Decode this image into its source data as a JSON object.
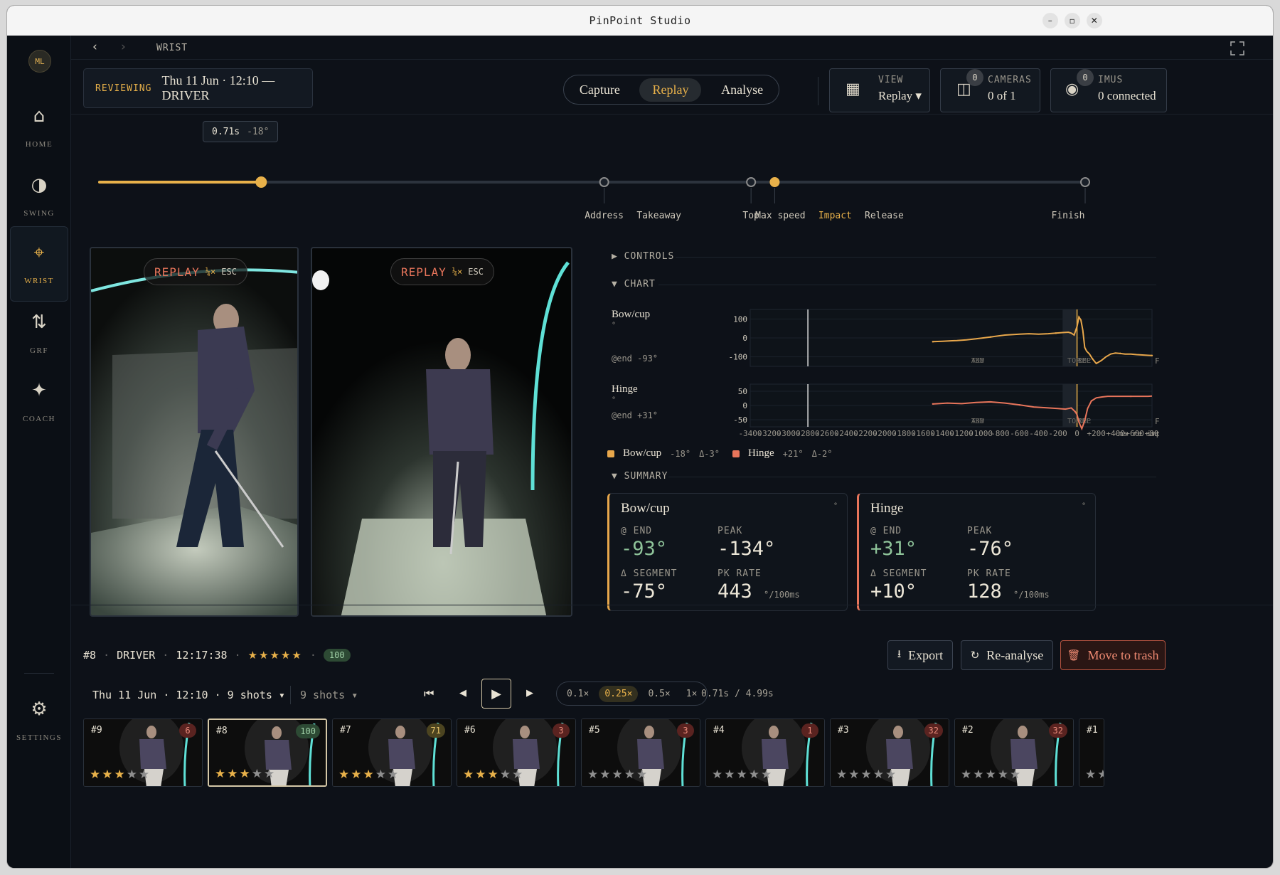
{
  "window": {
    "title": "PinPoint Studio",
    "controls": [
      "minimize-icon",
      "maximize-icon",
      "close-icon"
    ]
  },
  "sidebar": {
    "avatar": "ML",
    "items": [
      {
        "id": "home",
        "label": "HOME",
        "icon": "⌂"
      },
      {
        "id": "swing",
        "label": "SWING",
        "icon": "◑"
      },
      {
        "id": "wrist",
        "label": "WRIST",
        "icon": "⌖",
        "active": true
      },
      {
        "id": "grf",
        "label": "GRF",
        "icon": "⇅"
      },
      {
        "id": "coach",
        "label": "COACH",
        "icon": "✦"
      }
    ],
    "settings": {
      "label": "SETTINGS",
      "icon": "⚙"
    }
  },
  "topnav": {
    "back": "‹",
    "forward": "›",
    "breadcrumb": "WRIST"
  },
  "reviewing": {
    "tag": "REVIEWING",
    "session": "Thu 11 Jun · 12:10 — DRIVER"
  },
  "modes": {
    "items": [
      "Capture",
      "Replay",
      "Analyse"
    ],
    "active": "Replay"
  },
  "view": {
    "label": "VIEW",
    "value": "Replay ▾"
  },
  "cameras": {
    "label": "CAMERAS",
    "value": "0 of 1",
    "badge": "0"
  },
  "imus": {
    "label": "IMUS",
    "value": "0 connected",
    "badge": "0"
  },
  "scrubber": {
    "tooltip_time": "0.71s",
    "tooltip_angle": "-18°",
    "progress": 0.164,
    "events": [
      {
        "label": "Address",
        "pos": 0.512
      },
      {
        "label": "Takeaway",
        "pos": 0.512
      },
      {
        "label": "Top",
        "pos": 0.661
      },
      {
        "label": "Max speed",
        "pos": 0.685
      },
      {
        "label": "Impact",
        "pos": 0.685,
        "highlight": true
      },
      {
        "label": "Release",
        "pos": 0.685
      },
      {
        "label": "Finish",
        "pos": 1.0
      }
    ]
  },
  "videos": [
    {
      "id": "side",
      "replay_label": "REPLAY",
      "speed": "¼×",
      "esc": "ESC"
    },
    {
      "id": "front",
      "replay_label": "REPLAY",
      "speed": "¼×",
      "esc": "ESC"
    }
  ],
  "controls_header": "CONTROLS",
  "chart_header": "CHART",
  "summary_header": "SUMMARY",
  "chart_data": [
    {
      "type": "line",
      "title": "Bow/cup",
      "unit": "°",
      "end_label": "@end -93°",
      "ylim": [
        -150,
        150
      ],
      "yticks": [
        "100",
        "0",
        "-100"
      ],
      "series": [
        {
          "color": "#e8a74b",
          "x": [
            -1500,
            -1400,
            -1300,
            -1250,
            -1150,
            -1050,
            -900,
            -750,
            -600,
            -500,
            -400,
            -300,
            -220,
            -150,
            -90,
            -60,
            -30,
            0,
            20,
            40,
            60,
            80,
            100,
            130,
            160,
            200,
            250,
            300,
            350,
            400,
            450,
            500,
            560,
            620,
            680,
            740,
            780
          ],
          "values": [
            -20,
            -18,
            -15,
            -14,
            -10,
            -5,
            5,
            15,
            20,
            22,
            20,
            22,
            25,
            28,
            30,
            25,
            15,
            60,
            110,
            95,
            40,
            -50,
            -70,
            -85,
            -110,
            -135,
            -120,
            -100,
            -85,
            -80,
            -82,
            -85,
            -85,
            -88,
            -90,
            -92,
            -93
          ]
        }
      ],
      "markers": [
        "ADD",
        "TKW",
        "TOP",
        "IMP",
        "REL",
        "FIN"
      ]
    },
    {
      "type": "line",
      "title": "Hinge",
      "unit": "°",
      "end_label": "@end +31°",
      "ylim": [
        -70,
        70
      ],
      "yticks": [
        "50",
        "0",
        "-50"
      ],
      "series": [
        {
          "color": "#e8755b",
          "x": [
            -1500,
            -1350,
            -1200,
            -1050,
            -900,
            -750,
            -600,
            -450,
            -300,
            -200,
            -120,
            -60,
            -20,
            0,
            20,
            50,
            80,
            110,
            150,
            200,
            260,
            320,
            400,
            480,
            560,
            620,
            680,
            740,
            780
          ],
          "values": [
            5,
            8,
            6,
            10,
            12,
            8,
            2,
            -5,
            -8,
            -10,
            -12,
            -8,
            -20,
            -30,
            -55,
            -76,
            -50,
            -10,
            15,
            25,
            28,
            30,
            30,
            30,
            30,
            30,
            30,
            30,
            31
          ]
        }
      ],
      "markers": [
        "ADD",
        "TKW",
        "TOP",
        "IMP",
        "REL",
        "FIN"
      ]
    }
  ],
  "chart_xaxis": {
    "xlim": [
      -3400,
      780
    ],
    "ticks": [
      "-3400",
      "-3200",
      "-3000",
      "-2800",
      "-2600",
      "-2400",
      "-2200",
      "-2000",
      "-1800",
      "-1600",
      "-1400",
      "-1200",
      "-1000",
      "-800",
      "-600",
      "-400",
      "-200",
      "0",
      "+200",
      "+400",
      "+600",
      "+800",
      "-ms re impact"
    ]
  },
  "chart_legend": {
    "bow": "Bow/cup",
    "bow_val": "-18°",
    "bow_delta": "Δ-3°",
    "hinge": "Hinge",
    "hinge_val": "+21°",
    "hinge_delta": "Δ-2°",
    "fin": "FIN"
  },
  "summary": [
    {
      "name": "Bow/cup",
      "color": "#e8a74b",
      "end_k": "@ END",
      "end": "-93°",
      "peak_k": "PEAK",
      "peak": "-134°",
      "seg_k": "Δ SEGMENT",
      "seg": "-75°",
      "rate_k": "PK RATE",
      "rate": "443",
      "rate_u": "°/100ms",
      "unit": "°"
    },
    {
      "name": "Hinge",
      "color": "#e8755b",
      "end_k": "@ END",
      "end": "+31°",
      "peak_k": "PEAK",
      "peak": "-76°",
      "seg_k": "Δ SEGMENT",
      "seg": "+10°",
      "rate_k": "PK RATE",
      "rate": "128",
      "rate_u": "°/100ms",
      "unit": "°"
    }
  ],
  "shot": {
    "number": "#8",
    "club": "DRIVER",
    "time": "12:17:38",
    "stars": "★★★★★",
    "score": "100"
  },
  "actions": {
    "export": "Export",
    "reanalyse": "Re-analyse",
    "trash": "Move to trash"
  },
  "session_picker": {
    "label": "Thu 11 Jun · 12:10 · 9 shots ▾",
    "shots": "9 shots ▾"
  },
  "playback": {
    "first": "⏮",
    "prev": "◀",
    "play": "▶",
    "next": "▶",
    "speeds": [
      "0.1×",
      "0.25×",
      "0.5×",
      "1×"
    ],
    "speed_active": "0.25×",
    "position": "0.71s / 4.99s"
  },
  "thumbnails": [
    {
      "n": "#9",
      "score": "6",
      "stars": 3,
      "color": "red"
    },
    {
      "n": "#8",
      "score": "100",
      "stars": 3,
      "color": "green",
      "selected": true
    },
    {
      "n": "#7",
      "score": "71",
      "stars": 3,
      "color": "olive"
    },
    {
      "n": "#6",
      "score": "3",
      "stars": 3,
      "color": "red"
    },
    {
      "n": "#5",
      "score": "3",
      "stars": 0,
      "color": "red"
    },
    {
      "n": "#4",
      "score": "1",
      "stars": 0,
      "color": "red"
    },
    {
      "n": "#3",
      "score": "32",
      "stars": 0,
      "color": "red"
    },
    {
      "n": "#2",
      "score": "32",
      "stars": 0,
      "color": "red"
    },
    {
      "n": "#1",
      "score": "",
      "stars": 0,
      "color": "red"
    }
  ]
}
